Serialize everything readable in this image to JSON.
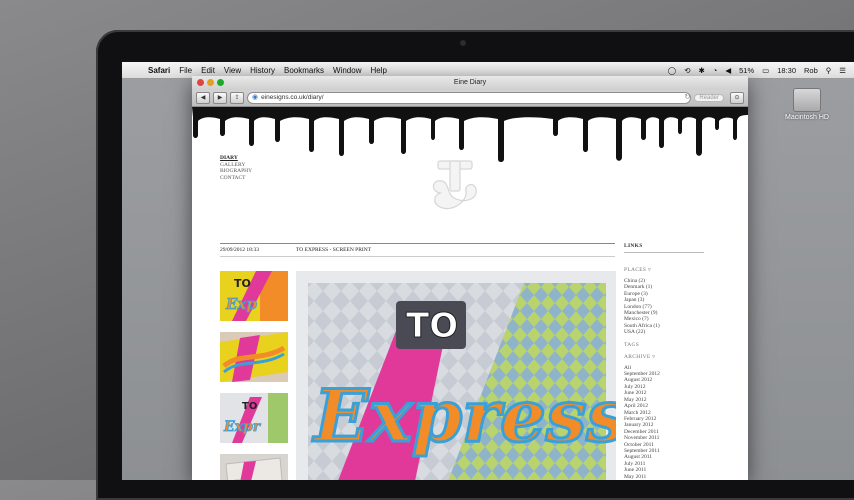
{
  "menubar": {
    "apple": "",
    "items": [
      "Safari",
      "File",
      "Edit",
      "View",
      "History",
      "Bookmarks",
      "Window",
      "Help"
    ],
    "battery": "51%",
    "time": "18:30",
    "user": "Rob"
  },
  "desktop": {
    "drive_label": "Macintosh HD"
  },
  "browser": {
    "title": "Eine Diary",
    "url": "einesigns.co.uk/diary/",
    "reader": "Reader"
  },
  "site": {
    "nav": [
      "DIARY",
      "GALLERY",
      "BIOGRAPHY",
      "CONTACT"
    ],
    "post": {
      "date": "29/09/2012 18:33",
      "title": "TO EXPRESS - SCREEN PRINT"
    },
    "artwork": {
      "to": "TO",
      "express": "Express"
    },
    "sidebar": {
      "links_heading": "LINKS",
      "places_heading": "PLACES",
      "places": [
        "China (2)",
        "Denmark (1)",
        "Europe (3)",
        "Japan (3)",
        "London (77)",
        "Manchester (9)",
        "Mexico (7)",
        "South Africa (1)",
        "USA (22)"
      ],
      "tags_heading": "TAGS",
      "archive_heading": "ARCHIVE",
      "archive": [
        "All",
        "September 2012",
        "August 2012",
        "July 2012",
        "June 2012",
        "May 2012",
        "April 2012",
        "March 2012",
        "February 2012",
        "January 2012",
        "December 2011",
        "November 2011",
        "October 2011",
        "September 2011",
        "August 2011",
        "July 2011",
        "June 2011",
        "May 2011",
        "April 2011",
        "March 2011",
        "October 2010"
      ]
    }
  },
  "colors": {
    "pink": "#e0399a",
    "orange": "#f28c28",
    "blue": "#3aa0d8",
    "yellow": "#e8d21e",
    "green": "#7ab648"
  }
}
